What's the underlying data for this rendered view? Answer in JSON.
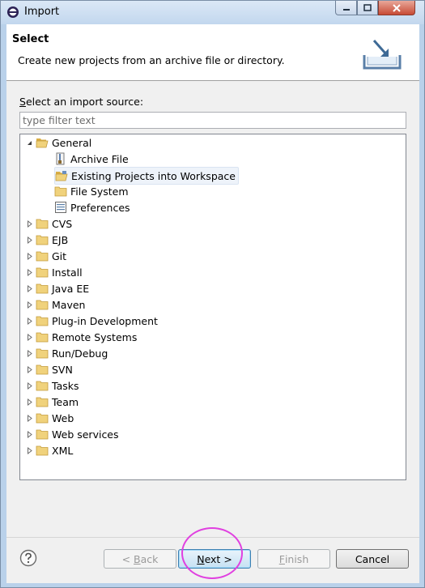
{
  "window": {
    "title": "Import"
  },
  "header": {
    "title": "Select",
    "description": "Create new projects from an archive file or directory."
  },
  "source": {
    "label": "Select an import source:",
    "filter_placeholder": "type filter text"
  },
  "tree": {
    "general": {
      "label": "General",
      "expanded": true,
      "icon": "folder-open-icon"
    },
    "general_children": [
      {
        "label": "Archive File",
        "icon": "archive-file-icon",
        "selected": false
      },
      {
        "label": "Existing Projects into Workspace",
        "icon": "project-folder-icon",
        "selected": true
      },
      {
        "label": "File System",
        "icon": "folder-icon",
        "selected": false
      },
      {
        "label": "Preferences",
        "icon": "preferences-icon",
        "selected": false
      }
    ],
    "categories": [
      {
        "label": "CVS"
      },
      {
        "label": "EJB"
      },
      {
        "label": "Git"
      },
      {
        "label": "Install"
      },
      {
        "label": "Java EE"
      },
      {
        "label": "Maven"
      },
      {
        "label": "Plug-in Development"
      },
      {
        "label": "Remote Systems"
      },
      {
        "label": "Run/Debug"
      },
      {
        "label": "SVN"
      },
      {
        "label": "Tasks"
      },
      {
        "label": "Team"
      },
      {
        "label": "Web"
      },
      {
        "label": "Web services"
      },
      {
        "label": "XML"
      }
    ]
  },
  "buttons": {
    "back": {
      "prefix": "< ",
      "mnemonic": "B",
      "rest": "ack",
      "enabled": false
    },
    "next": {
      "mnemonic": "N",
      "rest": "ext",
      "suffix": " >",
      "enabled": true
    },
    "finish": {
      "mnemonic": "F",
      "rest": "inish",
      "enabled": false
    },
    "cancel": {
      "label": "Cancel",
      "enabled": true
    }
  },
  "colors": {
    "selection": "#eef3fa",
    "folder": "#e8c265",
    "highlight_circle": "#e040e0"
  }
}
